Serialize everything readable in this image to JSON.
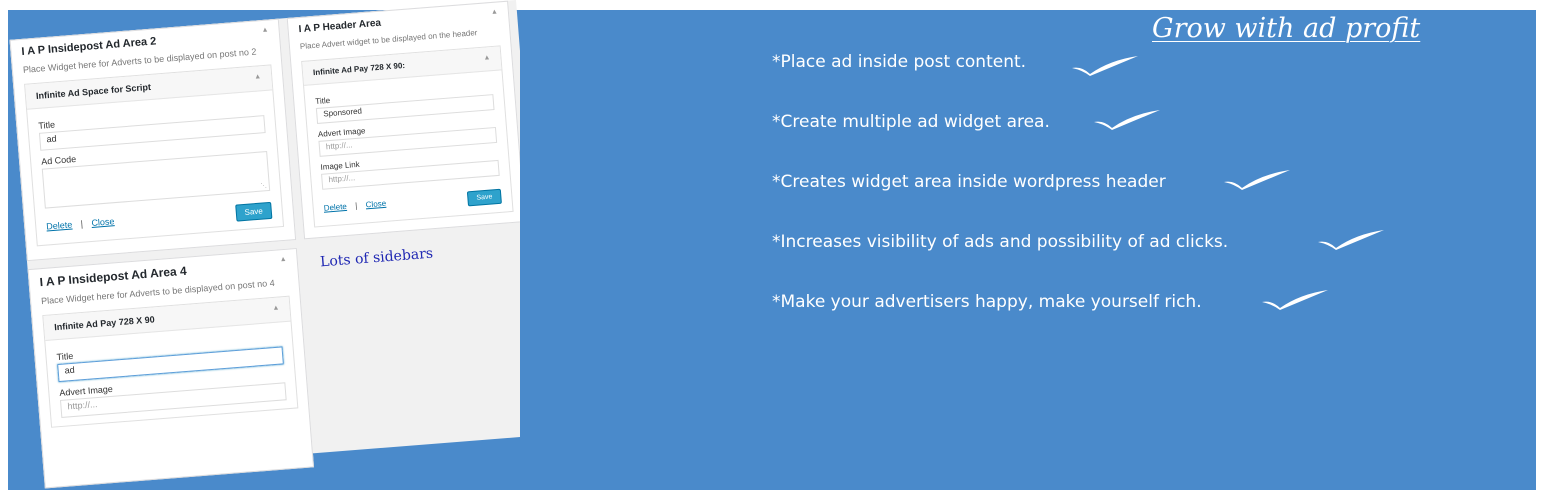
{
  "tagline": "Grow with ad profit",
  "features": [
    "*Place ad inside post content.",
    "*Create multiple ad widget area.",
    "*Creates widget area inside wordpress header",
    "*Increases visibility of ads and possibility of ad clicks.",
    "*Make your advertisers happy, make yourself rich."
  ],
  "note": "Lots of sidebars",
  "area2": {
    "title": "I A P Insidepost Ad Area 2",
    "desc": "Place Widget here for Adverts to be displayed on post no 2",
    "widget_title": "Infinite Ad Space for Script",
    "title_label": "Title",
    "title_value": "ad",
    "code_label": "Ad Code",
    "delete_label": "Delete",
    "sep": "|",
    "close_label": "Close",
    "save_label": "Save"
  },
  "area4": {
    "title": "I A P Insidepost Ad Area 4",
    "desc": "Place Widget here for Adverts to be displayed on post no 4",
    "widget_title": "Infinite Ad Pay 728 X 90",
    "title_label": "Title",
    "title_value": "ad",
    "image_label": "Advert Image",
    "image_placeholder": "http://..."
  },
  "header_area": {
    "title": "I A P Header Area",
    "desc": "Place Advert widget to be displayed on the header",
    "widget_title": "Infinite Ad Pay 728 X 90:",
    "title_label": "Title",
    "title_value": "Sponsored",
    "image_label": "Advert Image",
    "image_placeholder": "http://...",
    "link_label": "Image Link",
    "link_placeholder": "http://...",
    "delete_label": "Delete",
    "sep": "|",
    "close_label": "Close",
    "save_label": "Save"
  },
  "icons": {
    "collapse": "collapse-arrow-icon",
    "check": "checkmark-icon",
    "resize": "resize-grip-icon"
  },
  "colors": {
    "banner": "#4a8acb",
    "note": "#1f27b3",
    "save_button": "#2ea2cc",
    "link": "#0073aa"
  }
}
